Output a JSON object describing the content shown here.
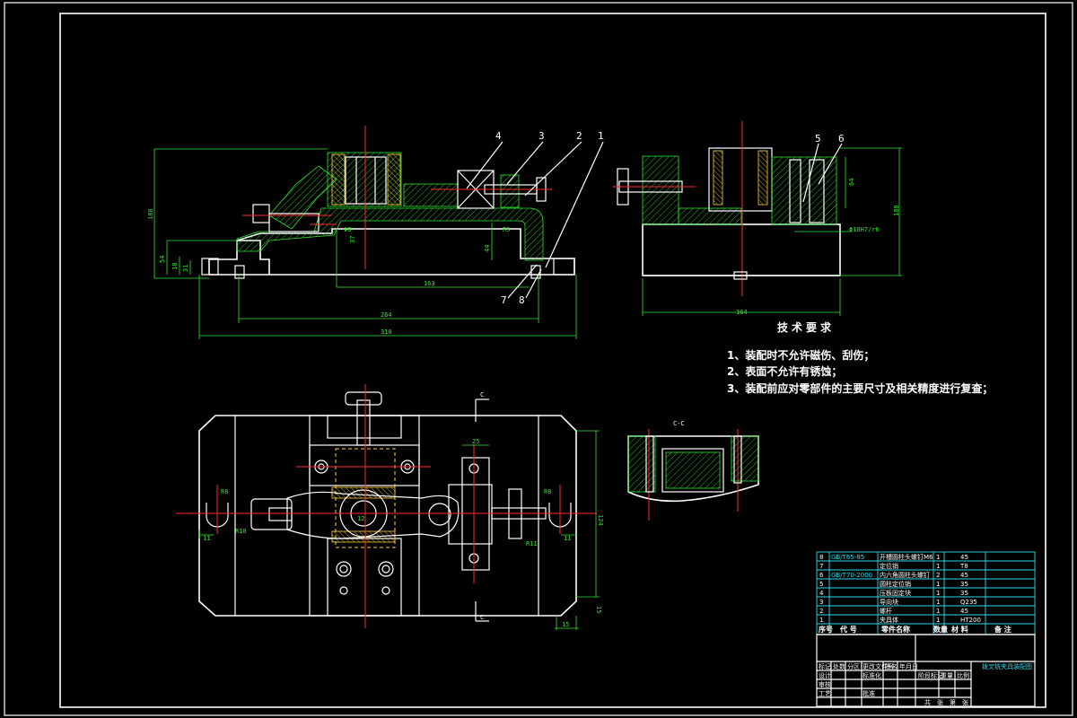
{
  "balloons": [
    "1",
    "2",
    "3",
    "4",
    "5",
    "6",
    "7",
    "8"
  ],
  "dimensions": {
    "front": [
      "180",
      "54",
      "18",
      "31",
      "Φ8",
      "37",
      "44",
      "R5",
      "163",
      "264",
      "310"
    ],
    "side": [
      "64",
      "188",
      "164",
      "Φ10H7/r6"
    ],
    "plan": [
      "25",
      "R8",
      "R10",
      "11",
      "R8",
      "R11",
      "11",
      "12",
      "124",
      "15"
    ],
    "section_mark": "C",
    "section_label": "C-C"
  },
  "tech_req": {
    "title": "技术要求",
    "items": [
      "1、装配时不允许磁伤、刮伤；",
      "2、表面不允许有锈蚀；",
      "3、装配前应对零部件的主要尺寸及相关精度进行复查；"
    ]
  },
  "bom": {
    "rows": [
      {
        "no": "8",
        "code": "GB/T65-85",
        "name": "开槽圆柱头螺钉M6",
        "qty": "1",
        "mat": "45"
      },
      {
        "no": "7",
        "code": "",
        "name": "定位销",
        "qty": "1",
        "mat": "T8"
      },
      {
        "no": "6",
        "code": "GB/T70-2000",
        "name": "内六角圆柱头螺钉",
        "qty": "2",
        "mat": "45"
      },
      {
        "no": "5",
        "code": "",
        "name": "圆柱定位销",
        "qty": "1",
        "mat": "35"
      },
      {
        "no": "4",
        "code": "",
        "name": "压板固定块",
        "qty": "1",
        "mat": "35"
      },
      {
        "no": "3",
        "code": "",
        "name": "导向块",
        "qty": "1",
        "mat": "Q235"
      },
      {
        "no": "2",
        "code": "",
        "name": "螺杆",
        "qty": "1",
        "mat": "45"
      },
      {
        "no": "1",
        "code": "",
        "name": "夹具体",
        "qty": "1",
        "mat": "HT200"
      }
    ],
    "header": [
      "序号",
      "代 号",
      "零件名称",
      "数量",
      "材 料",
      "备 注"
    ]
  },
  "title_block": {
    "drawing_title": "拨叉铣夹具装配图",
    "row_labels": [
      "标记",
      "处数",
      "分区",
      "更改文件号",
      "签名",
      "年月日"
    ],
    "row_labels2": [
      "设计",
      "标准化",
      "阶段标记",
      "重量",
      "比例"
    ],
    "row_labels3": [
      "审核",
      "工艺",
      "批准"
    ],
    "bottom": [
      "共",
      "张",
      "第",
      "张"
    ]
  },
  "colors": {
    "outline": "#ffffff",
    "center": "#ff2a2a",
    "dimension": "#2ee62e",
    "table": "#2fd8e8",
    "hidden": "#ffd23a",
    "background": "#000000"
  }
}
